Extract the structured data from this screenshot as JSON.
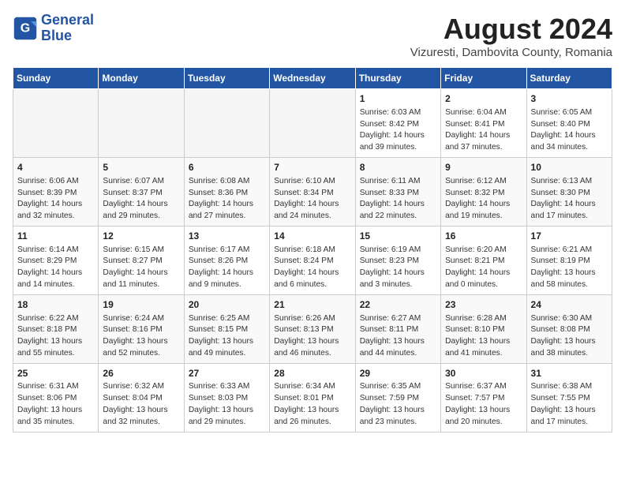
{
  "header": {
    "logo_line1": "General",
    "logo_line2": "Blue",
    "month_year": "August 2024",
    "location": "Vizuresti, Dambovita County, Romania"
  },
  "weekdays": [
    "Sunday",
    "Monday",
    "Tuesday",
    "Wednesday",
    "Thursday",
    "Friday",
    "Saturday"
  ],
  "weeks": [
    [
      {
        "day": "",
        "info": ""
      },
      {
        "day": "",
        "info": ""
      },
      {
        "day": "",
        "info": ""
      },
      {
        "day": "",
        "info": ""
      },
      {
        "day": "1",
        "info": "Sunrise: 6:03 AM\nSunset: 8:42 PM\nDaylight: 14 hours\nand 39 minutes."
      },
      {
        "day": "2",
        "info": "Sunrise: 6:04 AM\nSunset: 8:41 PM\nDaylight: 14 hours\nand 37 minutes."
      },
      {
        "day": "3",
        "info": "Sunrise: 6:05 AM\nSunset: 8:40 PM\nDaylight: 14 hours\nand 34 minutes."
      }
    ],
    [
      {
        "day": "4",
        "info": "Sunrise: 6:06 AM\nSunset: 8:39 PM\nDaylight: 14 hours\nand 32 minutes."
      },
      {
        "day": "5",
        "info": "Sunrise: 6:07 AM\nSunset: 8:37 PM\nDaylight: 14 hours\nand 29 minutes."
      },
      {
        "day": "6",
        "info": "Sunrise: 6:08 AM\nSunset: 8:36 PM\nDaylight: 14 hours\nand 27 minutes."
      },
      {
        "day": "7",
        "info": "Sunrise: 6:10 AM\nSunset: 8:34 PM\nDaylight: 14 hours\nand 24 minutes."
      },
      {
        "day": "8",
        "info": "Sunrise: 6:11 AM\nSunset: 8:33 PM\nDaylight: 14 hours\nand 22 minutes."
      },
      {
        "day": "9",
        "info": "Sunrise: 6:12 AM\nSunset: 8:32 PM\nDaylight: 14 hours\nand 19 minutes."
      },
      {
        "day": "10",
        "info": "Sunrise: 6:13 AM\nSunset: 8:30 PM\nDaylight: 14 hours\nand 17 minutes."
      }
    ],
    [
      {
        "day": "11",
        "info": "Sunrise: 6:14 AM\nSunset: 8:29 PM\nDaylight: 14 hours\nand 14 minutes."
      },
      {
        "day": "12",
        "info": "Sunrise: 6:15 AM\nSunset: 8:27 PM\nDaylight: 14 hours\nand 11 minutes."
      },
      {
        "day": "13",
        "info": "Sunrise: 6:17 AM\nSunset: 8:26 PM\nDaylight: 14 hours\nand 9 minutes."
      },
      {
        "day": "14",
        "info": "Sunrise: 6:18 AM\nSunset: 8:24 PM\nDaylight: 14 hours\nand 6 minutes."
      },
      {
        "day": "15",
        "info": "Sunrise: 6:19 AM\nSunset: 8:23 PM\nDaylight: 14 hours\nand 3 minutes."
      },
      {
        "day": "16",
        "info": "Sunrise: 6:20 AM\nSunset: 8:21 PM\nDaylight: 14 hours\nand 0 minutes."
      },
      {
        "day": "17",
        "info": "Sunrise: 6:21 AM\nSunset: 8:19 PM\nDaylight: 13 hours\nand 58 minutes."
      }
    ],
    [
      {
        "day": "18",
        "info": "Sunrise: 6:22 AM\nSunset: 8:18 PM\nDaylight: 13 hours\nand 55 minutes."
      },
      {
        "day": "19",
        "info": "Sunrise: 6:24 AM\nSunset: 8:16 PM\nDaylight: 13 hours\nand 52 minutes."
      },
      {
        "day": "20",
        "info": "Sunrise: 6:25 AM\nSunset: 8:15 PM\nDaylight: 13 hours\nand 49 minutes."
      },
      {
        "day": "21",
        "info": "Sunrise: 6:26 AM\nSunset: 8:13 PM\nDaylight: 13 hours\nand 46 minutes."
      },
      {
        "day": "22",
        "info": "Sunrise: 6:27 AM\nSunset: 8:11 PM\nDaylight: 13 hours\nand 44 minutes."
      },
      {
        "day": "23",
        "info": "Sunrise: 6:28 AM\nSunset: 8:10 PM\nDaylight: 13 hours\nand 41 minutes."
      },
      {
        "day": "24",
        "info": "Sunrise: 6:30 AM\nSunset: 8:08 PM\nDaylight: 13 hours\nand 38 minutes."
      }
    ],
    [
      {
        "day": "25",
        "info": "Sunrise: 6:31 AM\nSunset: 8:06 PM\nDaylight: 13 hours\nand 35 minutes."
      },
      {
        "day": "26",
        "info": "Sunrise: 6:32 AM\nSunset: 8:04 PM\nDaylight: 13 hours\nand 32 minutes."
      },
      {
        "day": "27",
        "info": "Sunrise: 6:33 AM\nSunset: 8:03 PM\nDaylight: 13 hours\nand 29 minutes."
      },
      {
        "day": "28",
        "info": "Sunrise: 6:34 AM\nSunset: 8:01 PM\nDaylight: 13 hours\nand 26 minutes."
      },
      {
        "day": "29",
        "info": "Sunrise: 6:35 AM\nSunset: 7:59 PM\nDaylight: 13 hours\nand 23 minutes."
      },
      {
        "day": "30",
        "info": "Sunrise: 6:37 AM\nSunset: 7:57 PM\nDaylight: 13 hours\nand 20 minutes."
      },
      {
        "day": "31",
        "info": "Sunrise: 6:38 AM\nSunset: 7:55 PM\nDaylight: 13 hours\nand 17 minutes."
      }
    ]
  ]
}
